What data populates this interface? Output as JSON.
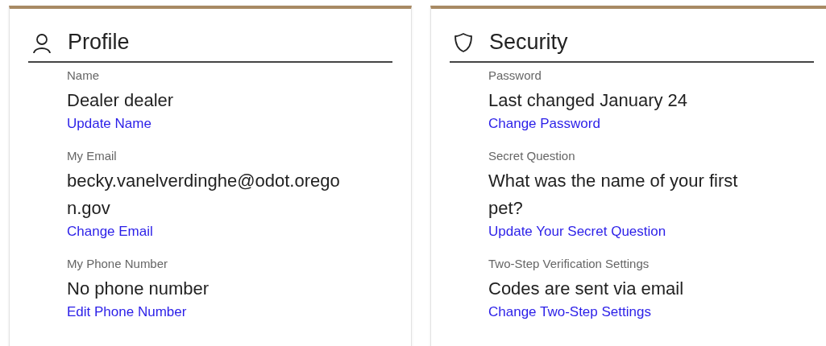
{
  "cards": [
    {
      "title": "Profile",
      "kind": "person",
      "fields": [
        {
          "label": "Name",
          "value": "Dealer dealer",
          "link": "Update Name"
        },
        {
          "label": "My Email",
          "value": "becky.vanelverdinghe@odot.oregon.gov",
          "link": "Change Email"
        },
        {
          "label": "My Phone Number",
          "value": "No phone number",
          "link": "Edit Phone Number"
        }
      ]
    },
    {
      "title": "Security",
      "kind": "shield",
      "fields": [
        {
          "label": "Password",
          "value": "Last changed January 24",
          "link": "Change Password"
        },
        {
          "label": "Secret Question",
          "value": "What was the name of your first pet?",
          "link": "Update Your Secret Question"
        },
        {
          "label": "Two-Step Verification Settings",
          "value": "Codes are sent via email",
          "link": "Change Two-Step Settings"
        }
      ]
    }
  ]
}
